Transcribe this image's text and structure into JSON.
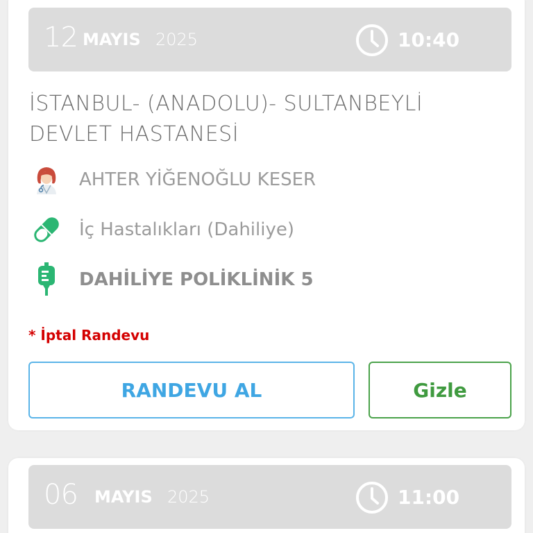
{
  "appointments": [
    {
      "day": "12",
      "month": "MAYIS",
      "year": "2025",
      "time": "10:40",
      "hospital": "İSTANBUL- (ANADOLU)- SULTANBEYLİ DEVLET HASTANESİ",
      "doctor": "AHTER YİĞENOĞLU KESER",
      "clinic": "İç Hastalıkları (Dahiliye)",
      "room": "DAHİLİYE POLİKLİNİK 5",
      "cancel_note": "* İptal Randevu",
      "book_button": "RANDEVU AL",
      "hide_button": "Gizle"
    },
    {
      "day": "06",
      "month": "MAYIS",
      "year": "2025",
      "time": "11:00"
    }
  ],
  "icons": {
    "doctor": "doctor-avatar-icon",
    "clinic": "pill-capsule-icon",
    "room": "iv-drip-icon",
    "time": "clock-icon"
  },
  "colors": {
    "header_bg": "#dcdcdc",
    "accent_blue": "#3fa6e3",
    "accent_green": "#3f9a3f",
    "cancel_red": "#d40000",
    "icon_green": "#2bb673"
  }
}
